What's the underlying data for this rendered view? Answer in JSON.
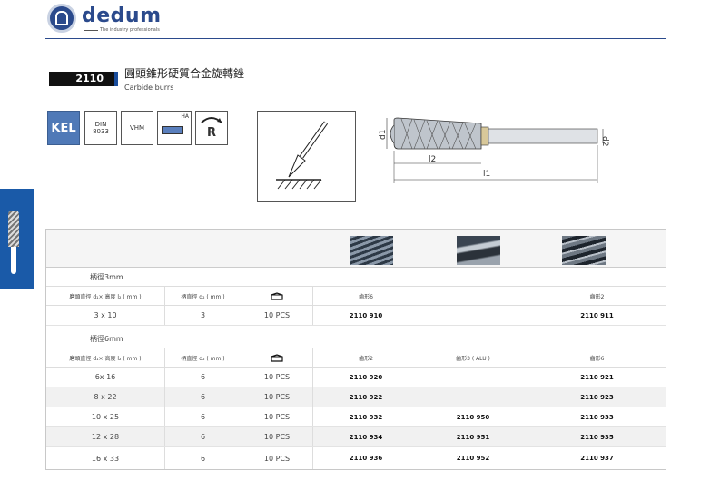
{
  "header": {
    "brand": "dedum",
    "tagline": "The industry professionals"
  },
  "product": {
    "code": "2110",
    "title_cn": "圓頭錐形硬質合金旋轉銼",
    "title_en": "Carbide burrs"
  },
  "specs": {
    "kel": "KEL",
    "din_line1": "DIN",
    "din_line2": "8033",
    "vhm": "VHM",
    "ha": "HA",
    "r": "R"
  },
  "diagram": {
    "d1": "d1",
    "d2": "d2",
    "l1": "l1",
    "l2": "l2"
  },
  "colors": {
    "brand_blue": "#2b4a8c",
    "side_tab": "#1a5aa8",
    "kel_blue": "#4f79b7"
  },
  "table": {
    "group1": {
      "label": "柄徑3mm",
      "headers": {
        "size": "磨頭直徑 d₁× 高度 l₂ ( mm )",
        "shank": "柄直徑 d₂ ( mm )",
        "pack_icon": "box-icon",
        "cut_a": "齒形6",
        "cut_b": "",
        "cut_c": "齒形2"
      },
      "rows": [
        {
          "size": "3 x 10",
          "shank": "3",
          "pack": "10  PCS",
          "a": "2110 910",
          "b": "",
          "c": "2110 911"
        }
      ]
    },
    "group2": {
      "label": "柄徑6mm",
      "headers": {
        "size": "磨頭直徑 d₁× 高度 l₂ ( mm )",
        "shank": "柄直徑 d₂ ( mm )",
        "pack_icon": "box-icon",
        "cut_a": "齒形2",
        "cut_b": "齒形3 ( ALU )",
        "cut_c": "齒形6"
      },
      "rows": [
        {
          "size": "6x 16",
          "shank": "6",
          "pack": "10  PCS",
          "a": "2110 920",
          "b": "",
          "c": "2110 921"
        },
        {
          "size": "8 x 22",
          "shank": "6",
          "pack": "10  PCS",
          "a": "2110 922",
          "b": "",
          "c": "2110 923"
        },
        {
          "size": "10 x 25",
          "shank": "6",
          "pack": "10  PCS",
          "a": "2110 932",
          "b": "2110 950",
          "c": "2110 933"
        },
        {
          "size": "12 x 28",
          "shank": "6",
          "pack": "10  PCS",
          "a": "2110 934",
          "b": "2110 951",
          "c": "2110 935"
        },
        {
          "size": "16 x 33",
          "shank": "6",
          "pack": "10  PCS",
          "a": "2110 936",
          "b": "2110 952",
          "c": "2110 937"
        }
      ]
    }
  }
}
